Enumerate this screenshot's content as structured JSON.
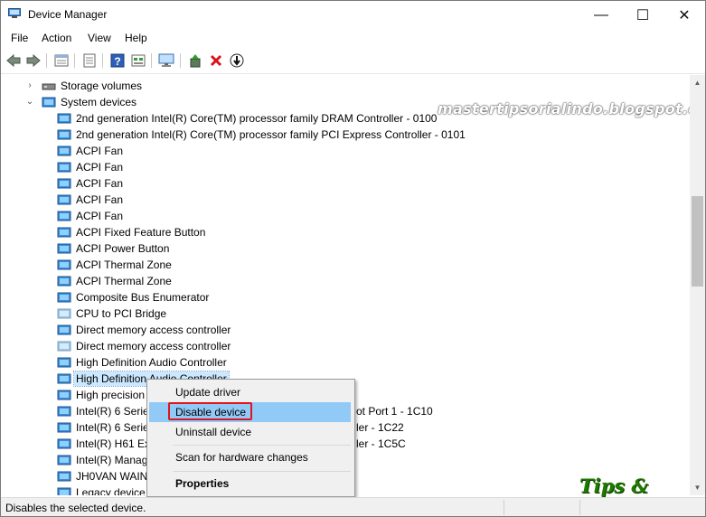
{
  "window": {
    "title": "Device Manager",
    "minimize_glyph": "—",
    "maximize_glyph": "☐",
    "close_glyph": "✕"
  },
  "menu": [
    "File",
    "Action",
    "View",
    "Help"
  ],
  "toolbar": {
    "buttons": [
      "back-icon",
      "forward-icon",
      "properties-icon",
      "show-hidden-icon",
      "help-icon",
      "view-icon",
      "monitor-icon",
      "update-driver-icon",
      "uninstall-icon",
      "disable-icon"
    ]
  },
  "watermark": "mastertipsorialindo.blogspot.com",
  "tree": {
    "categories": [
      {
        "label": "Storage volumes",
        "expanded": false
      },
      {
        "label": "System devices",
        "expanded": true
      }
    ],
    "devices": [
      "2nd generation Intel(R) Core(TM) processor family DRAM Controller - 0100",
      "2nd generation Intel(R) Core(TM) processor family PCI Express Controller - 0101",
      "ACPI Fan",
      "ACPI Fan",
      "ACPI Fan",
      "ACPI Fan",
      "ACPI Fan",
      "ACPI Fixed Feature Button",
      "ACPI Power Button",
      "ACPI Thermal Zone",
      "ACPI Thermal Zone",
      "Composite Bus Enumerator",
      "CPU to PCI Bridge",
      "Direct memory access controller",
      "Direct memory access controller",
      "High Definition Audio Controller",
      "High Definition Audio Controller",
      "High precision",
      "Intel(R) 6 Serie",
      "Intel(R) 6 Serie",
      "Intel(R) H61 Ex",
      "Intel(R) Manag",
      "JH0VAN WAIN",
      "Legacy device"
    ],
    "device_suffixes": {
      "18": "ot Port 1 - 1C10",
      "19": "ler - 1C22",
      "20": "ler - 1C5C"
    },
    "selected_index": 16
  },
  "context_menu": {
    "items": [
      "Update driver",
      "Disable device",
      "Uninstall device",
      "Scan for hardware changes",
      "Properties"
    ],
    "highlighted": "Disable device"
  },
  "status": {
    "text": "Disables the selected device."
  },
  "logo": "Tips & Tutorial",
  "colors": {
    "selection": "#cce8ff",
    "menu_hover": "#91c9f7",
    "highlight_box": "#e0151d",
    "logo_green": "#1f7a00"
  }
}
